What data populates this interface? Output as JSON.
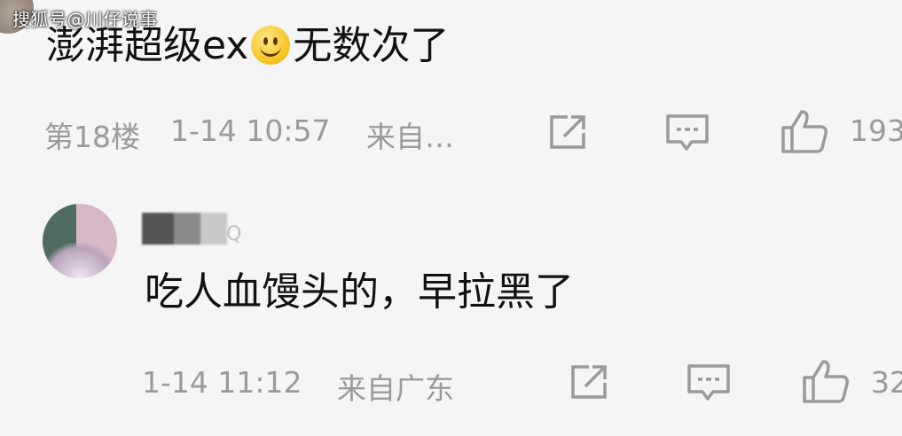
{
  "watermark": "搜狐号@川仔说事",
  "comments": [
    {
      "text_before_emoji": "澎湃超级ex",
      "emoji": "smiley-face",
      "text_after_emoji": "无数次了",
      "floor": "第18楼",
      "time": "1-14 10:57",
      "source": "来自…",
      "likes": "193"
    },
    {
      "username_visible": "Q",
      "text": "吃人血馒头的，早拉黑了",
      "time": "1-14 11:12",
      "source": "来自广东",
      "likes": "32"
    }
  ],
  "colors": {
    "background": "#f5f5f5",
    "text": "#111111",
    "meta": "#9a9a9a"
  }
}
